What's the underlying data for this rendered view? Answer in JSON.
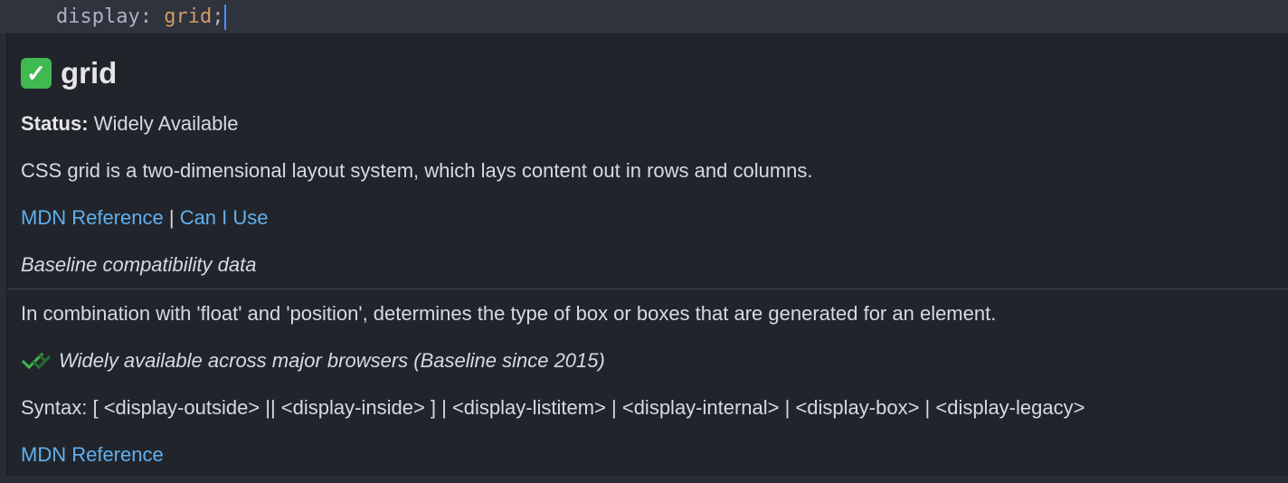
{
  "editor": {
    "property": "display",
    "colon": ": ",
    "value": "grid",
    "semicolon": ";"
  },
  "hover": {
    "title": "grid",
    "title_icon": "check-mark-button-icon",
    "status_label": "Status:",
    "status_value": "Widely Available",
    "description": "CSS grid is a two-dimensional layout system, which lays content out in rows and columns.",
    "links": {
      "mdn": "MDN Reference",
      "separator": "|",
      "caniuse": "Can I Use"
    },
    "baseline_data_label": "Baseline compatibility data",
    "property_description": "In combination with 'float' and 'position', determines the type of box or boxes that are generated for an element.",
    "baseline_text": "Widely available across major browsers (Baseline since 2015)",
    "baseline_icon": "baseline-check-icon",
    "syntax": "Syntax: [ <display-outside> || <display-inside> ] | <display-listitem> | <display-internal> | <display-box> | <display-legacy>",
    "mdn_reference_2": "MDN Reference"
  },
  "colors": {
    "link": "#61afef",
    "value": "#d19a66",
    "check_green": "#3fb950",
    "baseline_green": "#3fb950"
  }
}
